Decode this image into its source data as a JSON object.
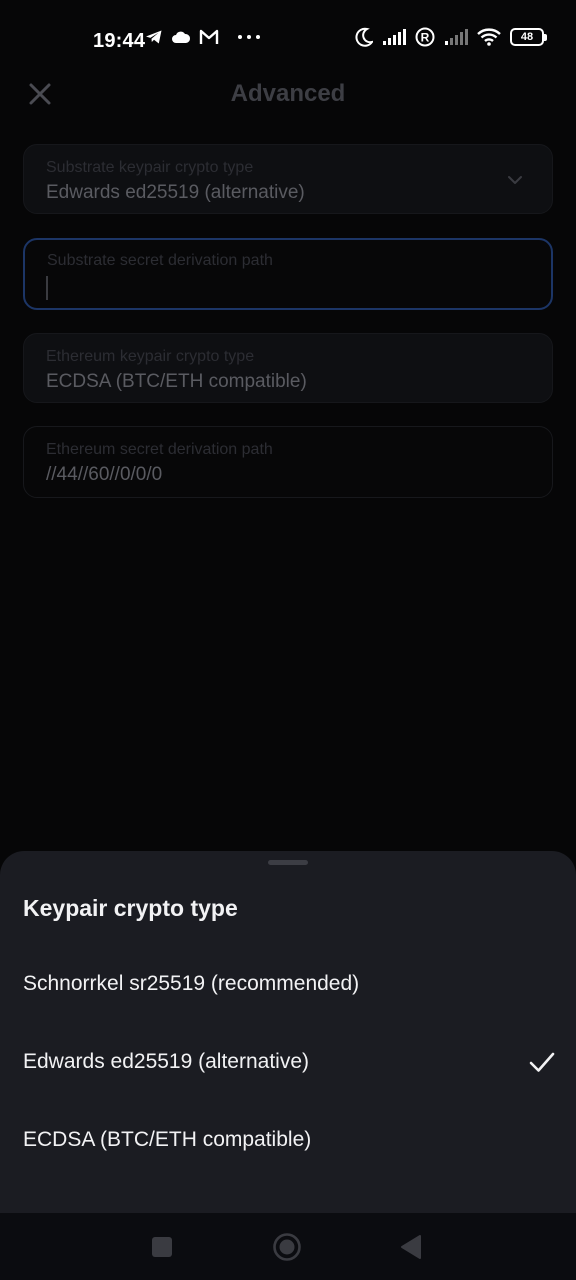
{
  "status_bar": {
    "time": "19:44",
    "left_icons": [
      "telegram-icon",
      "cloud-icon",
      "gmail-icon",
      "more-dots-icon"
    ],
    "right_icons": [
      "moon-icon",
      "signal-icon",
      "registered-icon",
      "signal-icon",
      "wifi-icon"
    ],
    "battery": "48"
  },
  "header": {
    "title": "Advanced",
    "close_icon": "close-icon"
  },
  "form": {
    "fields": [
      {
        "label": "Substrate keypair crypto type",
        "value": "Edwards ed25519 (alternative)"
      },
      {
        "label": "Substrate secret derivation path",
        "value": ""
      },
      {
        "label": "Ethereum keypair crypto type",
        "value": "ECDSA (BTC/ETH compatible)"
      },
      {
        "label": "Ethereum secret derivation path",
        "value": "//44//60//0/0/0"
      }
    ]
  },
  "sheet": {
    "title": "Keypair crypto type",
    "options": [
      {
        "label": "Schnorrkel sr25519 (recommended)",
        "selected": false
      },
      {
        "label": "Edwards ed25519 (alternative)",
        "selected": true
      },
      {
        "label": "ECDSA (BTC/ETH compatible)",
        "selected": false
      }
    ]
  },
  "nav": {
    "buttons": [
      "recents-icon",
      "home-icon",
      "back-icon"
    ]
  },
  "colors": {
    "background": "#060607",
    "sheet": "#1b1c22",
    "focus_border": "#1c3566"
  }
}
